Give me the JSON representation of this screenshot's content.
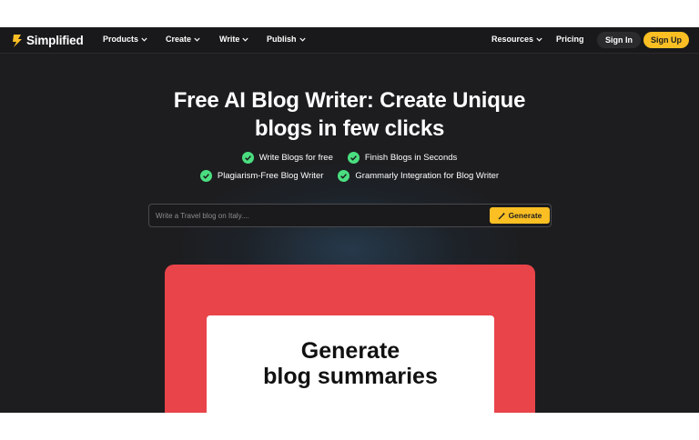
{
  "nav": {
    "logo": "Simplified",
    "items": [
      "Products",
      "Create",
      "Write",
      "Publish"
    ],
    "resources": "Resources",
    "pricing": "Pricing",
    "sign_in": "Sign In",
    "sign_up": "Sign Up"
  },
  "hero": {
    "title_line1": "Free AI Blog Writer: Create Unique",
    "title_line2": "blogs in few clicks",
    "features": [
      "Write Blogs for free",
      "Finish Blogs in Seconds",
      "Plagiarism-Free Blog Writer",
      "Grammarly Integration for Blog Writer"
    ]
  },
  "search": {
    "placeholder": "Write a Travel blog on Italy....",
    "value": "",
    "button_label": "Generate"
  },
  "preview": {
    "line1": "Generate",
    "line2": "blog summaries"
  },
  "colors": {
    "background": "#1d1d1f",
    "accent": "#fbbf24",
    "check": "#4ade80",
    "card_red": "#e8444a"
  }
}
